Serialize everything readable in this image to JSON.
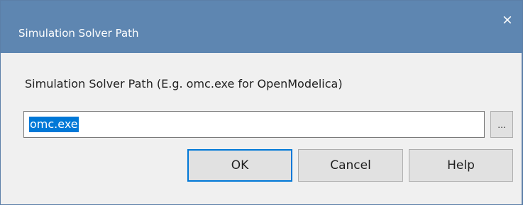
{
  "dialog": {
    "title": "Simulation Solver Path",
    "close_icon": "×"
  },
  "form": {
    "prompt": "Simulation Solver Path (E.g. omc.exe for OpenModelica)",
    "path_value": "omc.exe",
    "browse_label": "..."
  },
  "buttons": {
    "ok": "OK",
    "cancel": "Cancel",
    "help": "Help"
  },
  "colors": {
    "titlebar": "#5e86b1",
    "selection": "#0078d7",
    "focus_border": "#0078d7"
  }
}
